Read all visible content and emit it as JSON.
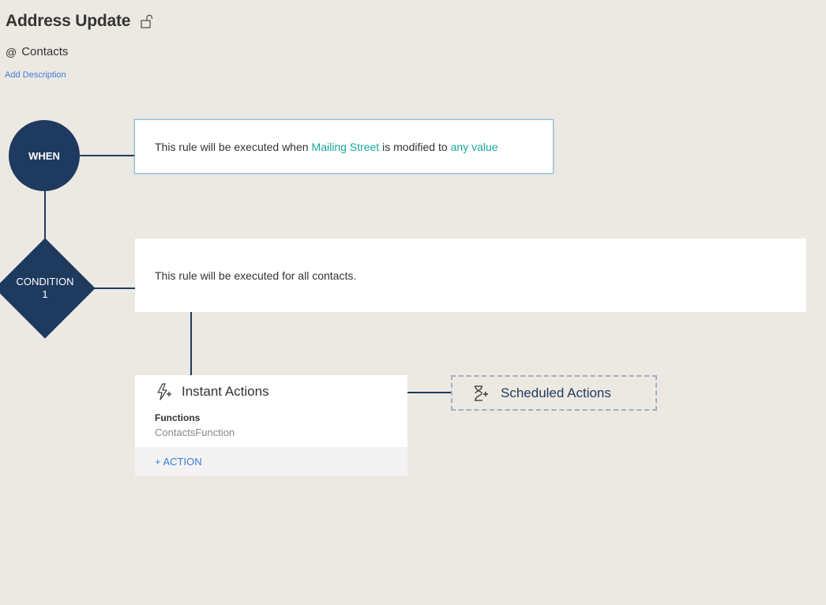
{
  "rule": {
    "title": "Address Update",
    "module_prefix": "@",
    "module": "Contacts",
    "add_description": "Add Description"
  },
  "when": {
    "label": "WHEN",
    "text_before": "This rule will be executed when",
    "field": "Mailing Street",
    "text_middle": "is modified to",
    "value": "any value"
  },
  "condition": {
    "label_line1": "CONDITION",
    "label_line2": "1",
    "text": "This rule will be executed for all contacts."
  },
  "instant_actions": {
    "title": "Instant Actions",
    "functions_label": "Functions",
    "functions_value": "ContactsFunction",
    "add_action": "+ ACTION"
  },
  "scheduled_actions": {
    "title": "Scheduled Actions"
  },
  "icons": {
    "lock": "unlock-icon",
    "instant": "lightning-plus-icon",
    "scheduled": "hourglass-plus-icon"
  },
  "colors": {
    "node": "#1f3a5f",
    "highlight": "#1aa79b",
    "link": "#3b7ed8",
    "background": "#ece9e3"
  }
}
